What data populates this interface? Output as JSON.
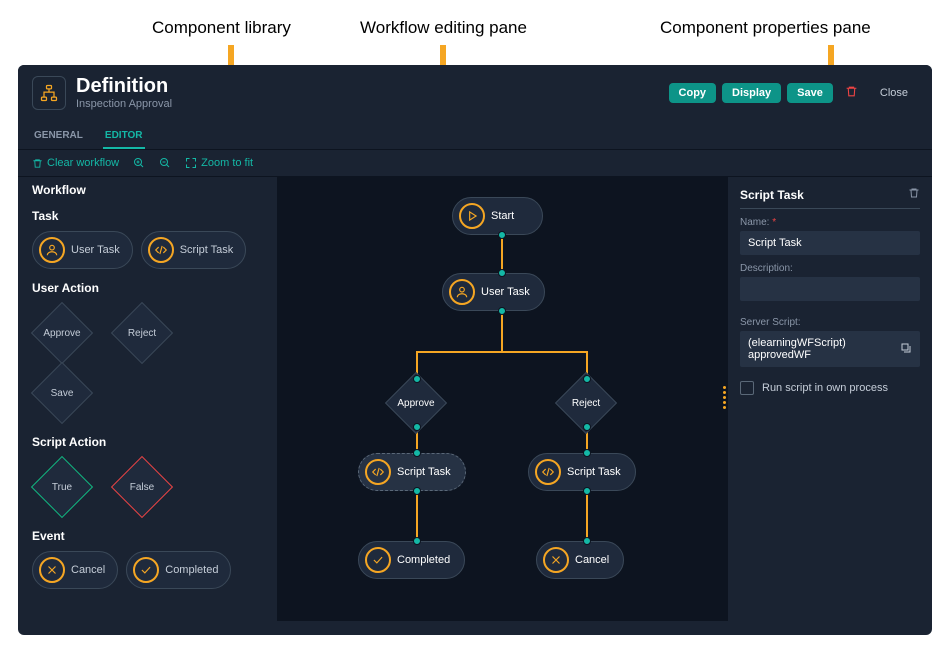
{
  "annotations": {
    "library": "Component library",
    "editing": "Workflow editing pane",
    "props": "Component properties pane"
  },
  "header": {
    "title": "Definition",
    "subtitle": "Inspection Approval",
    "copy": "Copy",
    "display": "Display",
    "save": "Save",
    "close": "Close"
  },
  "tabs": {
    "general": "GENERAL",
    "editor": "EDITOR"
  },
  "toolbar": {
    "clear": "Clear workflow",
    "zoomfit": "Zoom to fit"
  },
  "sidebar": {
    "heading": "Workflow",
    "sections": {
      "task": "Task",
      "useraction": "User Action",
      "scriptaction": "Script Action",
      "event": "Event"
    },
    "items": {
      "usertask": "User Task",
      "scripttask": "Script Task",
      "approve": "Approve",
      "reject": "Reject",
      "save": "Save",
      "true": "True",
      "false": "False",
      "cancel": "Cancel",
      "completed": "Completed"
    }
  },
  "canvas": {
    "start": "Start",
    "usertask": "User Task",
    "approve": "Approve",
    "reject": "Reject",
    "scripttask1": "Script Task",
    "scripttask2": "Script Task",
    "completed": "Completed",
    "cancel": "Cancel"
  },
  "props": {
    "title": "Script Task",
    "name_label": "Name:",
    "name_value": "Script Task",
    "desc_label": "Description:",
    "desc_value": "",
    "server_label": "Server Script:",
    "server_value": "(elearningWFScript) approvedWF",
    "checkbox_label": "Run script in own process"
  }
}
